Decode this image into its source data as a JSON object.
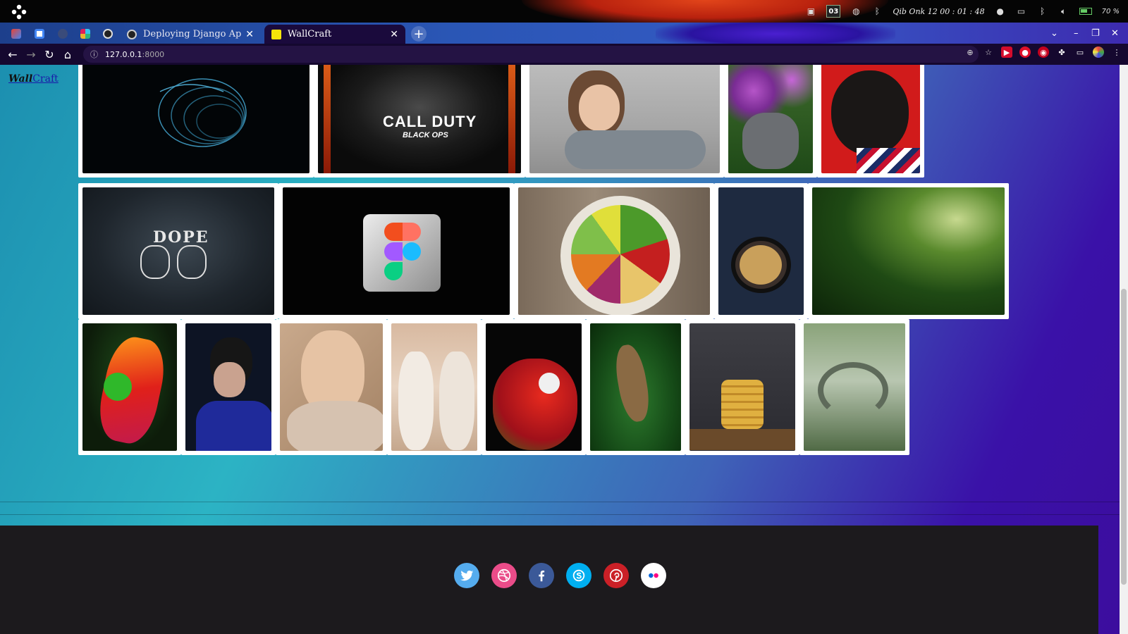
{
  "os_bar": {
    "clock": "Qib Onk 12  00 : 01 : 48",
    "calendar_day": "03",
    "battery": "70 %"
  },
  "browser": {
    "tabs": [
      {
        "label": "Deploying Django Applicat",
        "active": false
      },
      {
        "label": "WallCraft",
        "active": true
      }
    ],
    "address": {
      "host": "127.0.0.1",
      "port": ":8000"
    }
  },
  "site": {
    "brand_part1": "Wall",
    "brand_part2": "Craft"
  },
  "gallery": {
    "row1": [
      "abstract-spiral",
      "call-of-duty-black-ops",
      "curly-haired-child",
      "dog-in-flowers",
      "black-pug"
    ],
    "row2": [
      "dope-hands",
      "figma-logo-3d",
      "salad-bowl",
      "blueberry-oats",
      "jungle-forest"
    ],
    "row3": [
      "red-eyed-tree-frog",
      "woman-sunglasses",
      "woman-scarf",
      "white-horses",
      "red-macaw",
      "lizard-leaves",
      "pancakes-syrup",
      "stone-bridge"
    ],
    "cod_title": "CALL DUTY",
    "cod_subtitle": "BLACK OPS",
    "dope_text": "DOPE"
  },
  "footer": {
    "social": [
      "twitter",
      "dribbble",
      "facebook",
      "skype",
      "pinterest",
      "flickr"
    ]
  },
  "colors": {
    "twitter": "#55acee",
    "dribbble": "#ea4c89",
    "facebook": "#3b5998",
    "skype": "#00aff0",
    "pinterest": "#cb2027",
    "flickr": "#ffffff"
  }
}
